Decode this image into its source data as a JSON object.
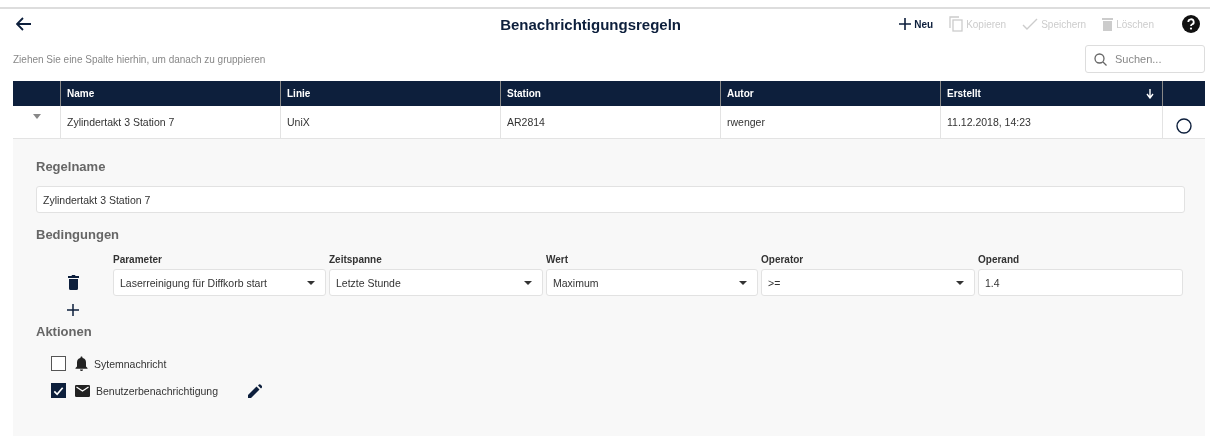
{
  "header": {
    "title": "Benachrichtigungsregeln",
    "actions": [
      {
        "kind": "new",
        "label": "Neu",
        "disabled": false
      },
      {
        "kind": "copy",
        "label": "Kopieren",
        "disabled": true
      },
      {
        "kind": "save",
        "label": "Speichern",
        "disabled": true
      },
      {
        "kind": "delete",
        "label": "Löschen",
        "disabled": true
      }
    ]
  },
  "group_hint": "Ziehen Sie eine Spalte hierhin, um danach zu gruppieren",
  "search": {
    "placeholder": "Suchen..."
  },
  "table": {
    "columns": [
      {
        "label": "Name",
        "sorted": false
      },
      {
        "label": "Linie",
        "sorted": false
      },
      {
        "label": "Station",
        "sorted": false
      },
      {
        "label": "Autor",
        "sorted": false
      },
      {
        "label": "Erstellt",
        "sorted": true
      }
    ],
    "rows": [
      {
        "expanded": true,
        "selected": false,
        "cells": [
          "Zylindertakt 3 Station 7",
          "UniX",
          "AR2814",
          "rwenger",
          "11.12.2018, 14:23"
        ]
      }
    ]
  },
  "detail": {
    "rule_name_label": "Regelname",
    "rule_name": "Zylindertakt 3 Station 7",
    "conditions_label": "Bedingungen",
    "condition_columns": [
      "Parameter",
      "Zeitspanne",
      "Wert",
      "Operator",
      "Operand"
    ],
    "conditions": [
      {
        "fields": [
          {
            "kind": "select",
            "value": "Laserreinigung für Diffkorb start"
          },
          {
            "kind": "select",
            "value": "Letzte Stunde"
          },
          {
            "kind": "select",
            "value": "Maximum"
          },
          {
            "kind": "select",
            "value": ">="
          },
          {
            "kind": "input",
            "value": "1.4"
          }
        ]
      }
    ],
    "actions_label": "Aktionen",
    "actions": [
      {
        "kind": "bell",
        "label": "Sytemnachricht",
        "checked": false,
        "editable": false
      },
      {
        "kind": "mail",
        "label": "Benutzerbenachrichtigung",
        "checked": true,
        "editable": true
      }
    ]
  }
}
